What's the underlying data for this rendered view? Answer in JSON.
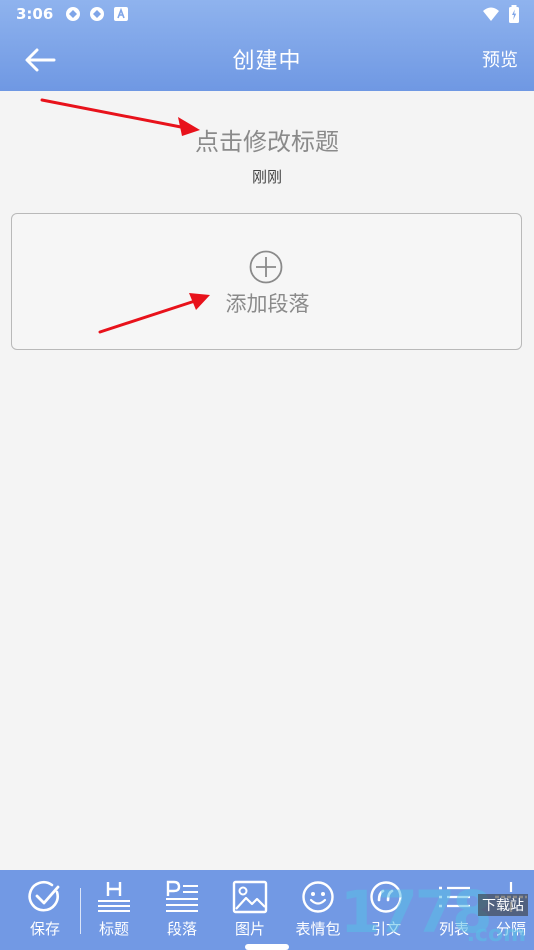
{
  "status": {
    "time": "3:06"
  },
  "appbar": {
    "title": "创建中",
    "preview_label": "预览"
  },
  "document": {
    "title_placeholder": "点击修改标题",
    "timestamp": "刚刚",
    "add_paragraph_label": "添加段落"
  },
  "toolbar": {
    "items": [
      {
        "label": "保存",
        "icon": "check-circle-icon"
      },
      {
        "label": "标题",
        "icon": "heading-icon"
      },
      {
        "label": "段落",
        "icon": "paragraph-icon"
      },
      {
        "label": "图片",
        "icon": "image-icon"
      },
      {
        "label": "表情包",
        "icon": "emoji-icon"
      },
      {
        "label": "引文",
        "icon": "quote-icon"
      },
      {
        "label": "列表",
        "icon": "list-icon"
      },
      {
        "label": "分隔",
        "icon": "divider-icon"
      }
    ]
  },
  "watermark": {
    "digits": "1778",
    "site": "下载站",
    "domain": ".com"
  },
  "colors": {
    "toolbar": "#7299e4",
    "annotation": "#e8121b"
  }
}
